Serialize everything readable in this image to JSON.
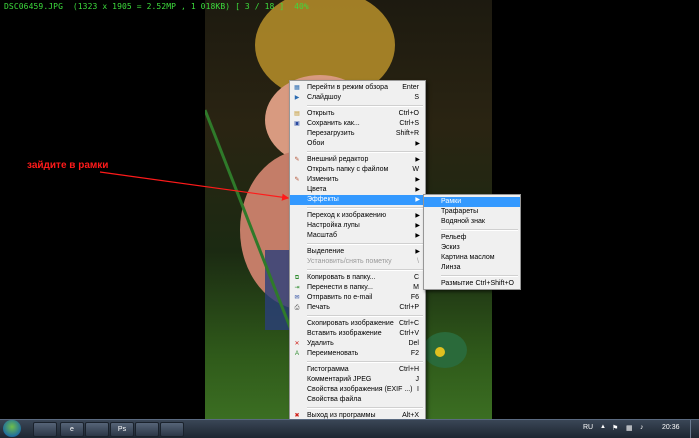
{
  "viewer": {
    "info": "DSC06459.JPG  (1323 x 1905 = 2.52MP , 1 018KB) [ 3 / 18 ]  40%"
  },
  "annotation": {
    "text": "зайдите в рамки",
    "color": "#ff1a1a"
  },
  "context_menu": {
    "items": [
      {
        "label": "Перейти в режим обзора",
        "shortcut": "Enter",
        "icon": "browse-icon"
      },
      {
        "label": "Слайдшоу",
        "shortcut": "S",
        "icon": "slideshow-icon"
      },
      {
        "sep": true
      },
      {
        "label": "Открыть",
        "shortcut": "Ctrl+O",
        "icon": "open-icon"
      },
      {
        "label": "Сохранить как...",
        "shortcut": "Ctrl+S",
        "icon": "save-icon"
      },
      {
        "label": "Перезагрузить",
        "shortcut": "Shift+R"
      },
      {
        "label": "Обои",
        "arrow": true
      },
      {
        "sep": true
      },
      {
        "label": "Внешний редактор",
        "arrow": true,
        "icon": "editor-icon"
      },
      {
        "label": "Открыть папку с файлом",
        "shortcut": "W"
      },
      {
        "label": "Изменить",
        "arrow": true,
        "icon": "edit-icon"
      },
      {
        "label": "Цвета",
        "arrow": true
      },
      {
        "label": "Эффекты",
        "arrow": true,
        "highlighted": true
      },
      {
        "sep": true
      },
      {
        "label": "Переход к изображению",
        "arrow": true
      },
      {
        "label": "Настройка лупы",
        "arrow": true
      },
      {
        "label": "Масштаб",
        "arrow": true
      },
      {
        "sep": true
      },
      {
        "label": "Выделение",
        "arrow": true
      },
      {
        "label": "Установить/снять пометку",
        "shortcut": "\\",
        "disabled": true
      },
      {
        "sep": true
      },
      {
        "label": "Копировать в папку...",
        "shortcut": "C",
        "icon": "copy-icon"
      },
      {
        "label": "Перенести в папку...",
        "shortcut": "M",
        "icon": "move-icon"
      },
      {
        "label": "Отправить по e-mail",
        "shortcut": "F6",
        "icon": "email-icon"
      },
      {
        "label": "Печать",
        "shortcut": "Ctrl+P",
        "icon": "print-icon"
      },
      {
        "sep": true
      },
      {
        "label": "Скопировать изображение",
        "shortcut": "Ctrl+C"
      },
      {
        "label": "Вставить изображение",
        "shortcut": "Ctrl+V"
      },
      {
        "label": "Удалить",
        "shortcut": "Del",
        "icon": "delete-icon"
      },
      {
        "label": "Переименовать",
        "shortcut": "F2",
        "icon": "rename-icon"
      },
      {
        "sep": true
      },
      {
        "label": "Гистограмма",
        "shortcut": "Ctrl+H"
      },
      {
        "label": "Комментарий JPEG",
        "shortcut": "J"
      },
      {
        "label": "Свойства изображения (EXIF ...)",
        "shortcut": "I"
      },
      {
        "label": "Свойства файла"
      },
      {
        "sep": true
      },
      {
        "label": "Выход из программы",
        "shortcut": "Alt+X",
        "icon": "exit-icon"
      }
    ]
  },
  "effects_submenu": {
    "items": [
      {
        "label": "Рамки",
        "highlighted": true
      },
      {
        "label": "Трафареты"
      },
      {
        "label": "Водяной знак"
      },
      {
        "sep": true
      },
      {
        "label": "Рельеф"
      },
      {
        "label": "Эскиз"
      },
      {
        "label": "Картина маслом"
      },
      {
        "label": "Линза"
      },
      {
        "sep": true
      },
      {
        "label": "Размытие",
        "shortcut": "Ctrl+Shift+O"
      }
    ]
  },
  "taskbar": {
    "apps": [
      "folder-icon",
      "ie-icon",
      "chrome-icon",
      "photoshop-icon",
      "paint-icon",
      "viewer-icon"
    ],
    "app_labels": [
      "",
      "e",
      "",
      "Ps",
      "",
      ""
    ],
    "lang": "RU",
    "time": "20:36"
  },
  "colors": {
    "highlight": "#3399ff",
    "annotation": "#ff1a1a",
    "info_text": "#3ddc3d"
  }
}
